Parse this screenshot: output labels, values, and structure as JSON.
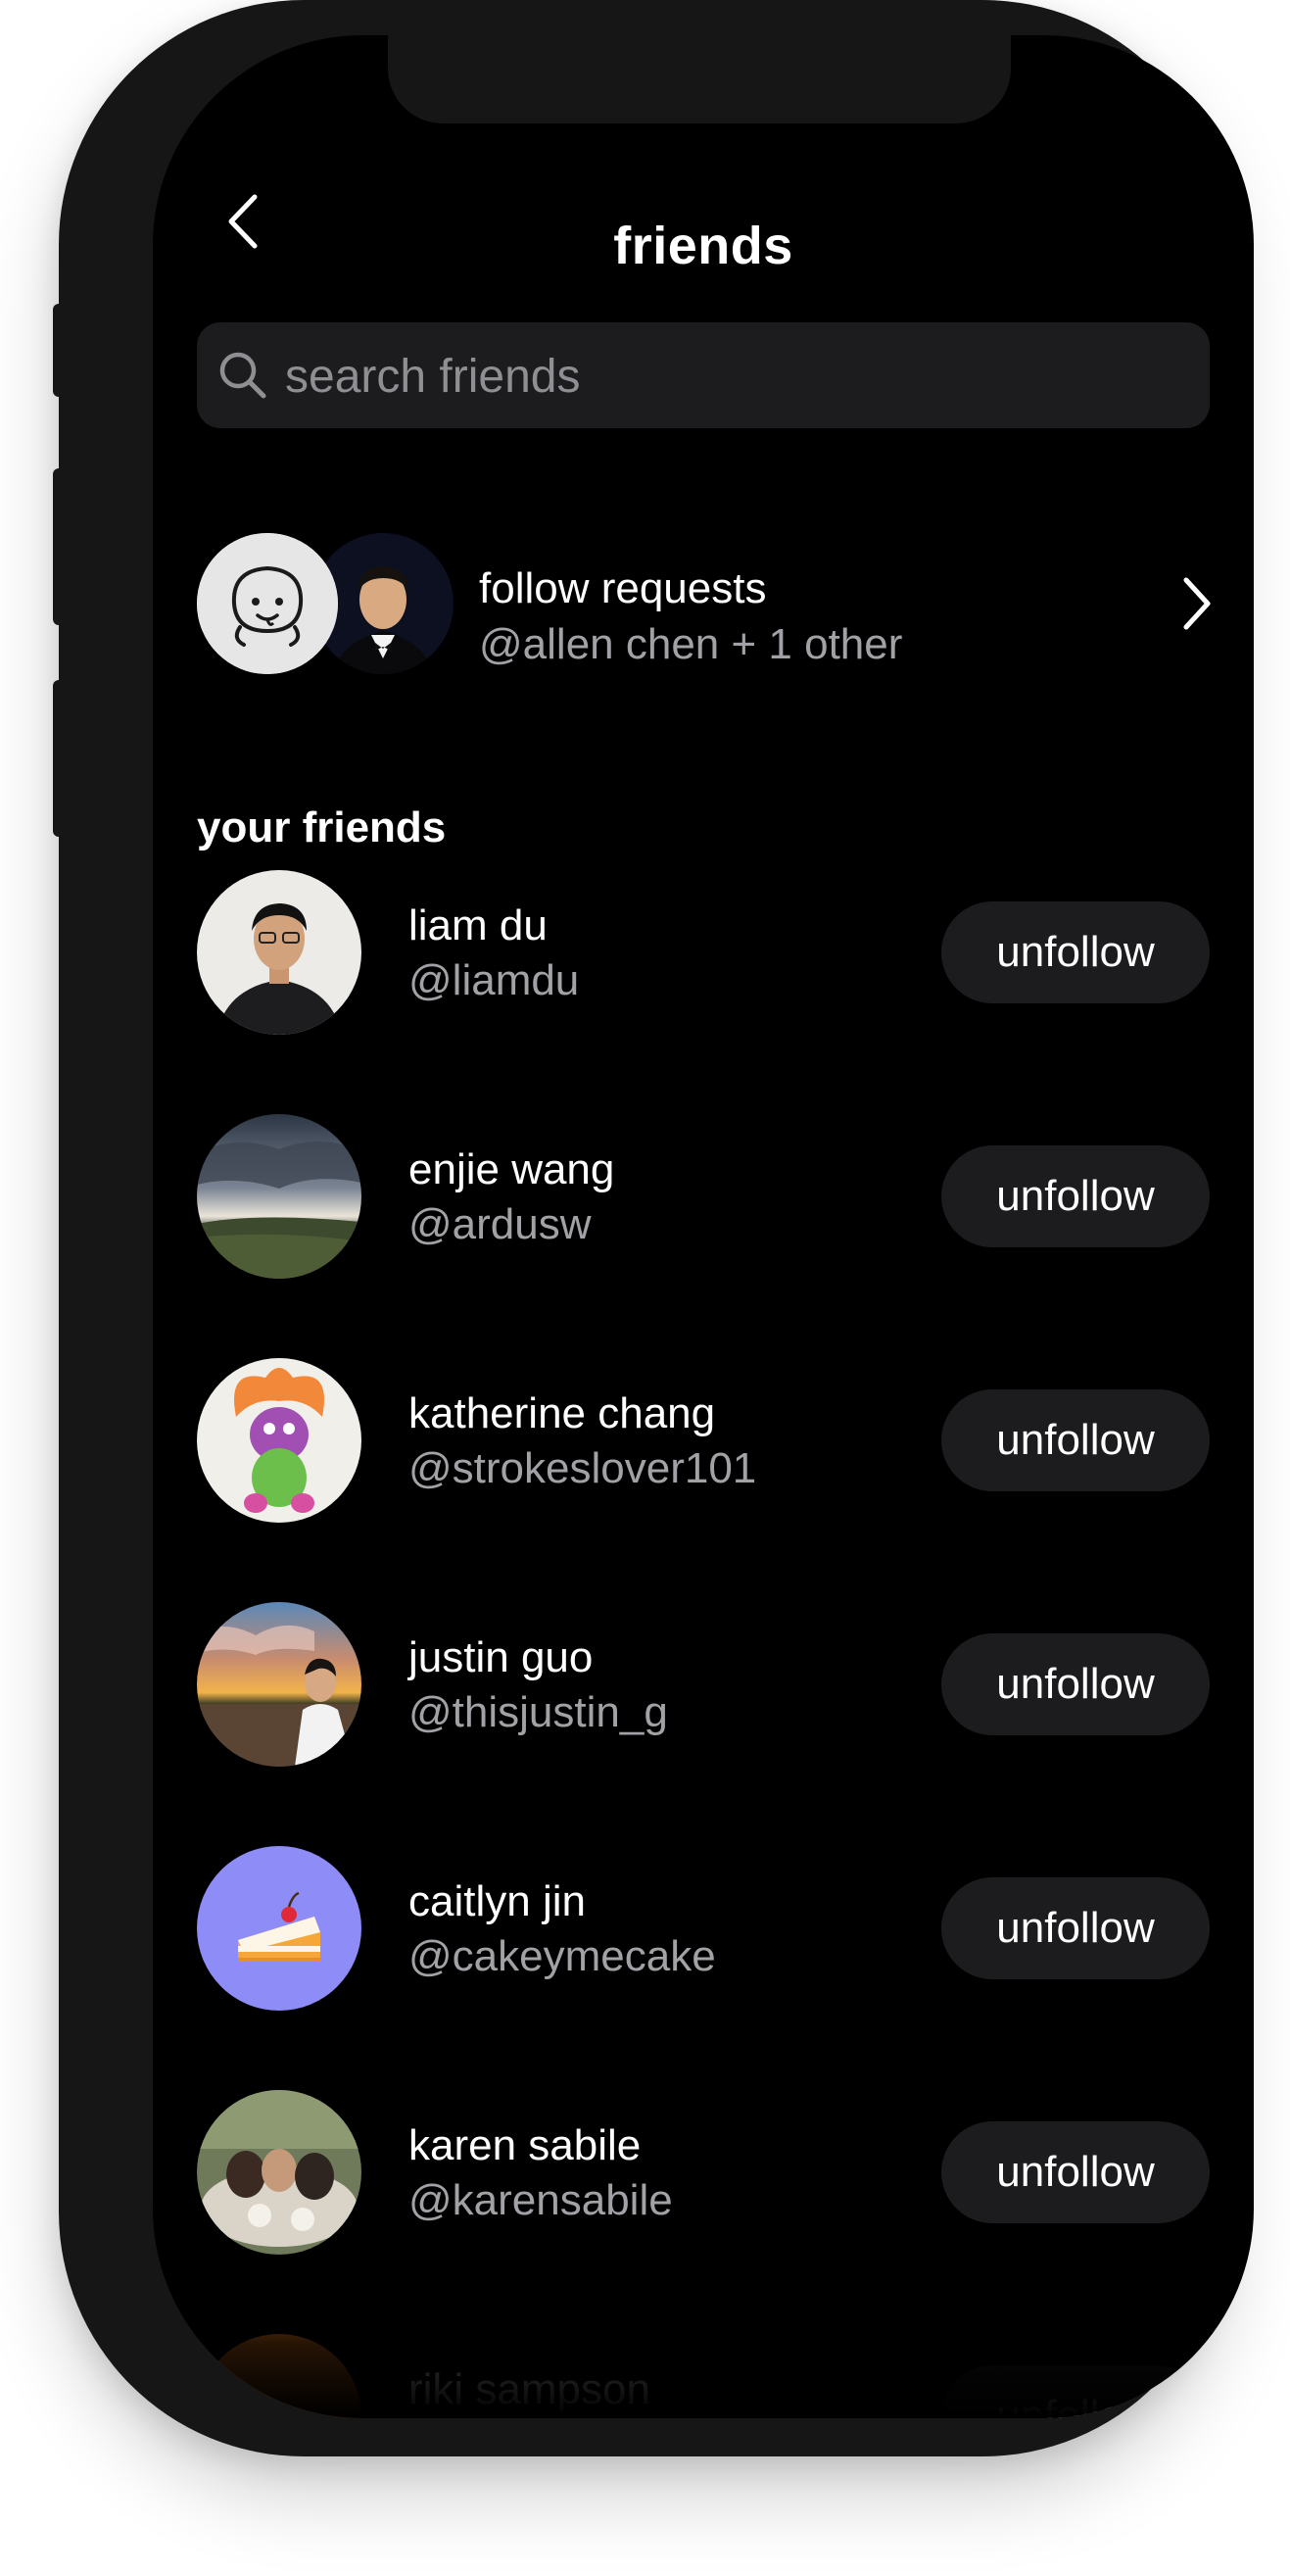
{
  "header": {
    "title": "friends",
    "back_icon": "chevron-left-icon"
  },
  "search": {
    "placeholder": "search friends",
    "value": "",
    "icon": "search-icon"
  },
  "follow_requests": {
    "title": "follow requests",
    "subtitle": "@allen chen + 1 other",
    "chevron_icon": "chevron-right-icon"
  },
  "section": {
    "title": "your friends"
  },
  "friends": [
    {
      "name": "liam du",
      "handle": "@liamdu",
      "action": "unfollow"
    },
    {
      "name": "enjie wang",
      "handle": "@ardusw",
      "action": "unfollow"
    },
    {
      "name": "katherine chang",
      "handle": "@strokeslover101",
      "action": "unfollow"
    },
    {
      "name": "justin guo",
      "handle": "@thisjustin_g",
      "action": "unfollow"
    },
    {
      "name": "caitlyn jin",
      "handle": "@cakeymecake",
      "action": "unfollow"
    },
    {
      "name": "karen sabile",
      "handle": "@karensabile",
      "action": "unfollow"
    },
    {
      "name": "riki sampson",
      "handle": "",
      "action": "unfollow"
    }
  ],
  "colors": {
    "background": "#000000",
    "surface": "#1c1c1e",
    "text_primary": "#ffffff",
    "text_secondary": "#a1a1a6",
    "device_frame": "#161616",
    "cake_avatar_bg": "#8e8cf7"
  }
}
